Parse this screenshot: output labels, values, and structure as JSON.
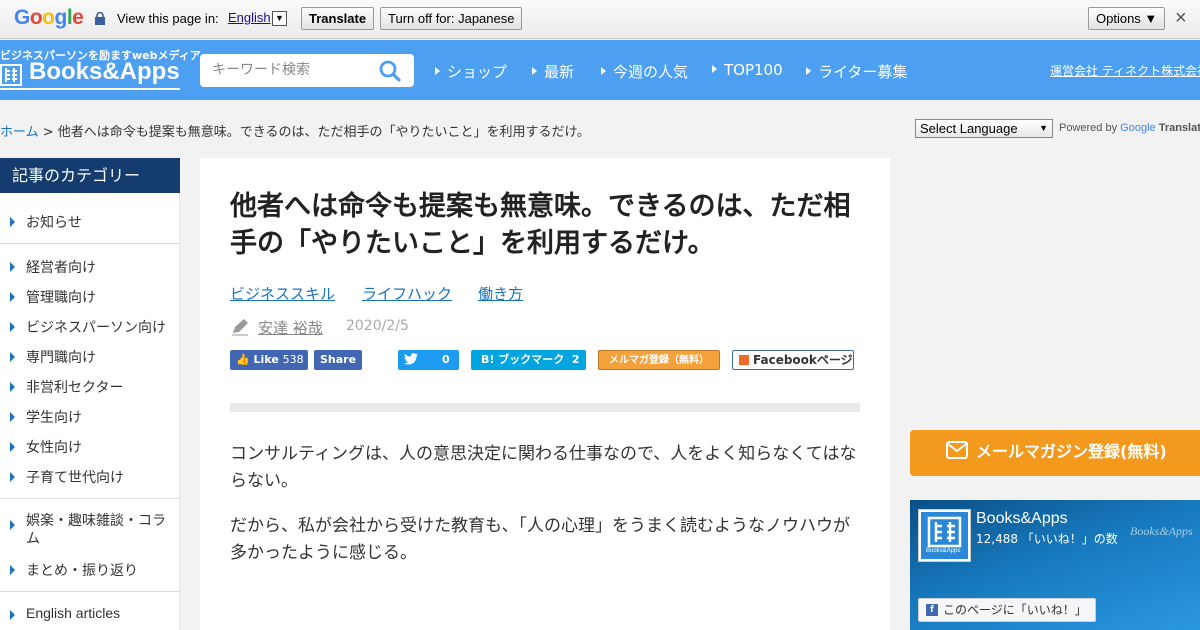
{
  "translate_bar": {
    "logo": "Google",
    "view_label": "View this page in:",
    "language": "English",
    "translate_button": "Translate",
    "turn_off_button": "Turn off for: Japanese",
    "options_button": "Options ▼",
    "close": "×"
  },
  "header": {
    "tagline": "ビジネスパーソンを励ますwebメディア",
    "logo_text": "Books&Apps",
    "search_placeholder": "キーワード検索",
    "nav": [
      "ショップ",
      "最新",
      "今週の人気",
      "TOP100",
      "ライター募集"
    ],
    "company_link": "運営会社 ティネクト株式会社"
  },
  "breadcrumb": {
    "home": "ホーム",
    "separator": " > ",
    "current": "他者へは命令も提案も無意味。できるのは、ただ相手の「やりたいこと」を利用するだけ。"
  },
  "language_select": {
    "value": "Select Language",
    "powered_by": "Powered by",
    "google": "Google",
    "translate": "Translate"
  },
  "sidebar": {
    "heading": "記事のカテゴリー",
    "groups": [
      [
        "お知らせ"
      ],
      [
        "経営者向け",
        "管理職向け",
        "ビジネスパーソン向け",
        "専門職向け",
        "非営利セクター",
        "学生向け",
        "女性向け",
        "子育て世代向け"
      ],
      [
        "娯楽・趣味雑談・コラム",
        "まとめ・振り返り"
      ],
      [
        "English articles"
      ]
    ]
  },
  "article": {
    "title": "他者へは命令も提案も無意味。できるのは、ただ相手の「やりたいこと」を利用するだけ。",
    "tags": [
      "ビジネススキル",
      "ライフハック",
      "働き方"
    ],
    "author": "安達 裕哉",
    "date": "2020/2/5",
    "share": {
      "fb_like": "Like",
      "fb_like_count": "538",
      "fb_share": "Share",
      "twitter_count": "0",
      "hatena": "B! ブックマーク",
      "hatena_count": "2",
      "mailmag": "メルマガ登録（無料）",
      "facebook_page": "Facebookページ"
    },
    "paragraphs": [
      "コンサルティングは、人の意思決定に関わる仕事なので、人をよく知らなくてはならない。",
      "だから、私が会社から受けた教育も、「人の心理」をうまく読むようなノウハウが多かったように感じる。"
    ]
  },
  "right": {
    "mail_button": "メールマガジン登録(無料)",
    "fb_page_name": "Books&Apps",
    "fb_likes": "12,488 「いいね！」の数",
    "fb_watermark": "Books&Apps",
    "fb_like_button": "このページに「いいね！」",
    "fb_thumb_text": "Books&Apps"
  },
  "colors": {
    "header_blue": "#4d9ff1",
    "sidebar_head": "#143c6e",
    "link_blue": "#1a74c4",
    "mail_orange": "#f39a1e"
  }
}
